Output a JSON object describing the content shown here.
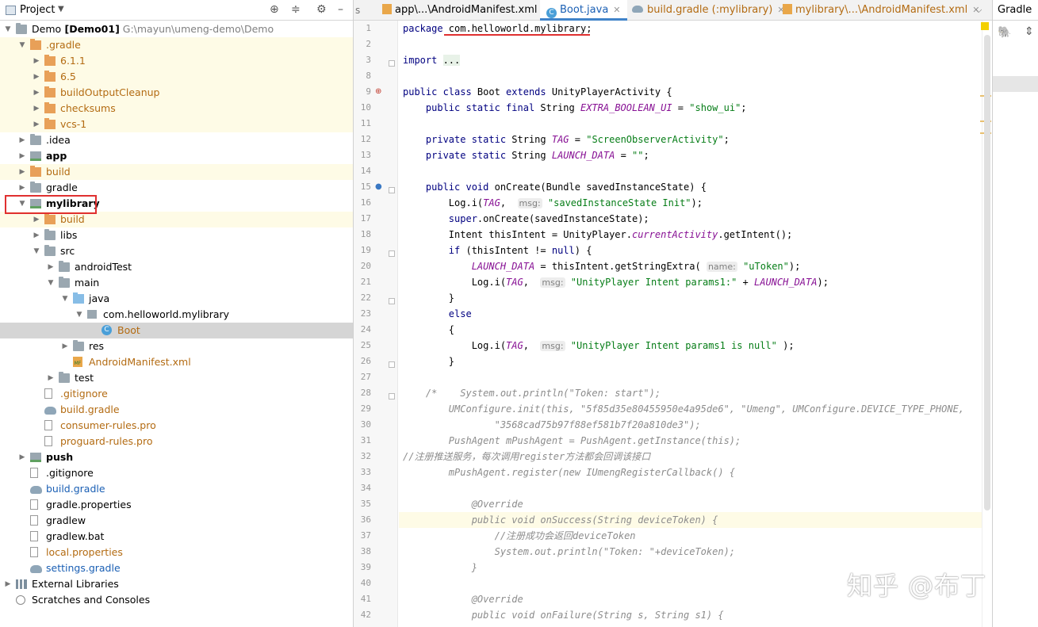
{
  "project_panel": {
    "title": "Project",
    "tree": [
      {
        "label": "Demo",
        "suffix": "[Demo01]",
        "path": "G:\\mayun\\umeng-demo\\Demo"
      },
      {
        "label": ".gradle"
      },
      {
        "label": "6.1.1"
      },
      {
        "label": "6.5"
      },
      {
        "label": "buildOutputCleanup"
      },
      {
        "label": "checksums"
      },
      {
        "label": "vcs-1"
      },
      {
        "label": ".idea"
      },
      {
        "label": "app"
      },
      {
        "label": "build"
      },
      {
        "label": "gradle"
      },
      {
        "label": "mylibrary"
      },
      {
        "label": "build"
      },
      {
        "label": "libs"
      },
      {
        "label": "src"
      },
      {
        "label": "androidTest"
      },
      {
        "label": "main"
      },
      {
        "label": "java"
      },
      {
        "label": "com.helloworld.mylibrary"
      },
      {
        "label": "Boot"
      },
      {
        "label": "res"
      },
      {
        "label": "AndroidManifest.xml"
      },
      {
        "label": "test"
      },
      {
        "label": ".gitignore"
      },
      {
        "label": "build.gradle"
      },
      {
        "label": "consumer-rules.pro"
      },
      {
        "label": "proguard-rules.pro"
      },
      {
        "label": "push"
      },
      {
        "label": ".gitignore"
      },
      {
        "label": "build.gradle"
      },
      {
        "label": "gradle.properties"
      },
      {
        "label": "gradlew"
      },
      {
        "label": "gradlew.bat"
      },
      {
        "label": "local.properties"
      },
      {
        "label": "settings.gradle"
      },
      {
        "label": "External Libraries"
      },
      {
        "label": "Scratches and Consoles"
      }
    ]
  },
  "tabs": [
    {
      "label": "app\\...\\AndroidManifest.xml",
      "icon": "manifest-icon"
    },
    {
      "label": "Boot.java",
      "icon": "class-icon"
    },
    {
      "label": "build.gradle (:mylibrary)",
      "icon": "gradle-icon"
    },
    {
      "label": "mylibrary\\...\\AndroidManifest.xml",
      "icon": "manifest-icon"
    }
  ],
  "right_panel": {
    "title": "Gradle"
  },
  "editor": {
    "line_numbers": [
      "1",
      "2",
      "3",
      "8",
      "9",
      "10",
      "11",
      "12",
      "13",
      "14",
      "15",
      "16",
      "17",
      "18",
      "19",
      "20",
      "21",
      "22",
      "23",
      "24",
      "25",
      "26",
      "27",
      "28",
      "29",
      "30",
      "31",
      "32",
      "33",
      "34",
      "35",
      "36",
      "37",
      "38",
      "39",
      "40",
      "41",
      "42"
    ],
    "lines": [
      [
        {
          "t": "kw",
          "v": "package "
        },
        {
          "t": "",
          "v": "com.helloworld.mylibrary;"
        }
      ],
      [],
      [
        {
          "t": "kw",
          "v": "import "
        },
        {
          "t": "fold",
          "v": "..."
        }
      ],
      [],
      [
        {
          "t": "kw",
          "v": "public class "
        },
        {
          "t": "",
          "v": "Boot "
        },
        {
          "t": "kw",
          "v": "extends "
        },
        {
          "t": "",
          "v": "UnityPlayerActivity {"
        }
      ],
      [
        {
          "t": "",
          "v": "    "
        },
        {
          "t": "kw",
          "v": "public static final "
        },
        {
          "t": "",
          "v": "String "
        },
        {
          "t": "fld",
          "v": "EXTRA_BOOLEAN_UI"
        },
        {
          "t": "",
          "v": " = "
        },
        {
          "t": "str",
          "v": "\"show_ui\""
        },
        {
          "t": "",
          "v": ";"
        }
      ],
      [],
      [
        {
          "t": "",
          "v": "    "
        },
        {
          "t": "kw",
          "v": "private static "
        },
        {
          "t": "",
          "v": "String "
        },
        {
          "t": "fld",
          "v": "TAG"
        },
        {
          "t": "",
          "v": " = "
        },
        {
          "t": "str",
          "v": "\"ScreenObserverActivity\""
        },
        {
          "t": "",
          "v": ";"
        }
      ],
      [
        {
          "t": "",
          "v": "    "
        },
        {
          "t": "kw",
          "v": "private static "
        },
        {
          "t": "",
          "v": "String "
        },
        {
          "t": "fld",
          "v": "LAUNCH_DATA"
        },
        {
          "t": "",
          "v": " = "
        },
        {
          "t": "str",
          "v": "\"\""
        },
        {
          "t": "",
          "v": ";"
        }
      ],
      [],
      [
        {
          "t": "",
          "v": "    "
        },
        {
          "t": "kw",
          "v": "public void "
        },
        {
          "t": "",
          "v": "onCreate(Bundle savedInstanceState) {"
        }
      ],
      [
        {
          "t": "",
          "v": "        Log.i("
        },
        {
          "t": "fld",
          "v": "TAG"
        },
        {
          "t": "",
          "v": ",  "
        },
        {
          "t": "hint",
          "v": "msg:"
        },
        {
          "t": "",
          "v": " "
        },
        {
          "t": "str",
          "v": "\"savedInstanceState Init\""
        },
        {
          "t": "",
          "v": ");"
        }
      ],
      [
        {
          "t": "",
          "v": "        "
        },
        {
          "t": "kw",
          "v": "super"
        },
        {
          "t": "",
          "v": ".onCreate(savedInstanceState);"
        }
      ],
      [
        {
          "t": "",
          "v": "        Intent thisIntent = UnityPlayer."
        },
        {
          "t": "fld",
          "v": "currentActivity"
        },
        {
          "t": "",
          "v": ".getIntent();"
        }
      ],
      [
        {
          "t": "",
          "v": "        "
        },
        {
          "t": "kw",
          "v": "if "
        },
        {
          "t": "",
          "v": "(thisIntent != "
        },
        {
          "t": "kw",
          "v": "null"
        },
        {
          "t": "",
          "v": ") {"
        }
      ],
      [
        {
          "t": "",
          "v": "            "
        },
        {
          "t": "fld",
          "v": "LAUNCH_DATA"
        },
        {
          "t": "",
          "v": " = thisIntent.getStringExtra( "
        },
        {
          "t": "hint",
          "v": "name:"
        },
        {
          "t": "",
          "v": " "
        },
        {
          "t": "str",
          "v": "\"uToken\""
        },
        {
          "t": "",
          "v": ");"
        }
      ],
      [
        {
          "t": "",
          "v": "            Log.i("
        },
        {
          "t": "fld",
          "v": "TAG"
        },
        {
          "t": "",
          "v": ",  "
        },
        {
          "t": "hint",
          "v": "msg:"
        },
        {
          "t": "",
          "v": " "
        },
        {
          "t": "str",
          "v": "\"UnityPlayer Intent params1:\""
        },
        {
          "t": "",
          "v": " + "
        },
        {
          "t": "fld",
          "v": "LAUNCH_DATA"
        },
        {
          "t": "",
          "v": ");"
        }
      ],
      [
        {
          "t": "",
          "v": "        }"
        }
      ],
      [
        {
          "t": "",
          "v": "        "
        },
        {
          "t": "kw",
          "v": "else"
        }
      ],
      [
        {
          "t": "",
          "v": "        {"
        }
      ],
      [
        {
          "t": "",
          "v": "            Log.i("
        },
        {
          "t": "fld",
          "v": "TAG"
        },
        {
          "t": "",
          "v": ",  "
        },
        {
          "t": "hint",
          "v": "msg:"
        },
        {
          "t": "",
          "v": " "
        },
        {
          "t": "str",
          "v": "\"UnityPlayer Intent params1 is null\""
        },
        {
          "t": "",
          "v": " );"
        }
      ],
      [
        {
          "t": "",
          "v": "        }"
        }
      ],
      [],
      [
        {
          "t": "cm",
          "v": "    /*    System.out.println(\"Token: start\");"
        }
      ],
      [
        {
          "t": "cm",
          "v": "        UMConfigure.init(this, \"5f85d35e80455950e4a95de6\", \"Umeng\", UMConfigure.DEVICE_TYPE_PHONE,"
        }
      ],
      [
        {
          "t": "cm",
          "v": "                \"3568cad75b97f88ef581b7f20a810de3\");"
        }
      ],
      [
        {
          "t": "cm",
          "v": "        PushAgent mPushAgent = PushAgent.getInstance(this);"
        }
      ],
      [
        {
          "t": "cm",
          "v": "//注册推送服务，每次调用register方法都会回调该接口"
        }
      ],
      [
        {
          "t": "cm",
          "v": "        mPushAgent.register(new IUmengRegisterCallback() {"
        }
      ],
      [],
      [
        {
          "t": "cm",
          "v": "            @Override"
        }
      ],
      [
        {
          "t": "cm",
          "v": "            public void onSuccess(String deviceToken) {"
        }
      ],
      [
        {
          "t": "cm",
          "v": "                //注册成功会返回deviceToken"
        }
      ],
      [
        {
          "t": "cm",
          "v": "                System.out.println(\"Token: \"+deviceToken);"
        }
      ],
      [
        {
          "t": "cm",
          "v": "            }"
        }
      ],
      [],
      [
        {
          "t": "cm",
          "v": "            @Override"
        }
      ],
      [
        {
          "t": "cm",
          "v": "            public void onFailure(String s, String s1) {"
        }
      ]
    ]
  },
  "watermark": "知乎 @布丁",
  "colors": {
    "selection": "#d5d5d5",
    "highlight": "#fefbe6",
    "annotation_box": "#e03030",
    "keyword": "#000080",
    "string": "#067d17",
    "field": "#871094",
    "comment": "#8c8c8c"
  }
}
